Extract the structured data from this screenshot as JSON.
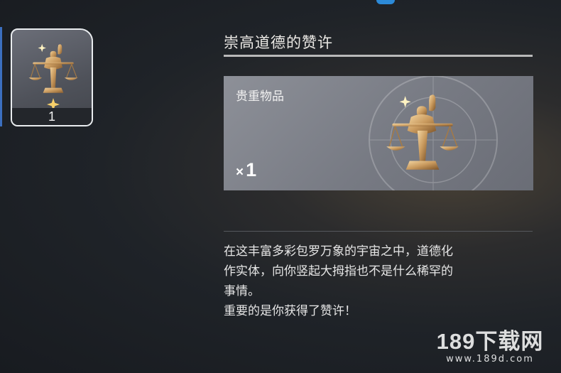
{
  "item_slot": {
    "count": "1",
    "icon": "golden-scales-thumbs-up-icon"
  },
  "detail": {
    "title": "崇高道德的赞许",
    "category": "贵重物品",
    "quantity_prefix": "×",
    "quantity": "1",
    "description": [
      "在这丰富多彩包罗万象的宇宙之中，道德化",
      "作实体，向你竖起大拇指也不是什么稀罕的",
      "事情。",
      "重要的是你获得了赞许！"
    ]
  },
  "watermark": {
    "main": "189下载网",
    "sub": "www.189d.com"
  },
  "colors": {
    "accent_blue": "#2c8ad8",
    "item_gold": "#c9a06a",
    "card_bg": "#7f828a"
  }
}
